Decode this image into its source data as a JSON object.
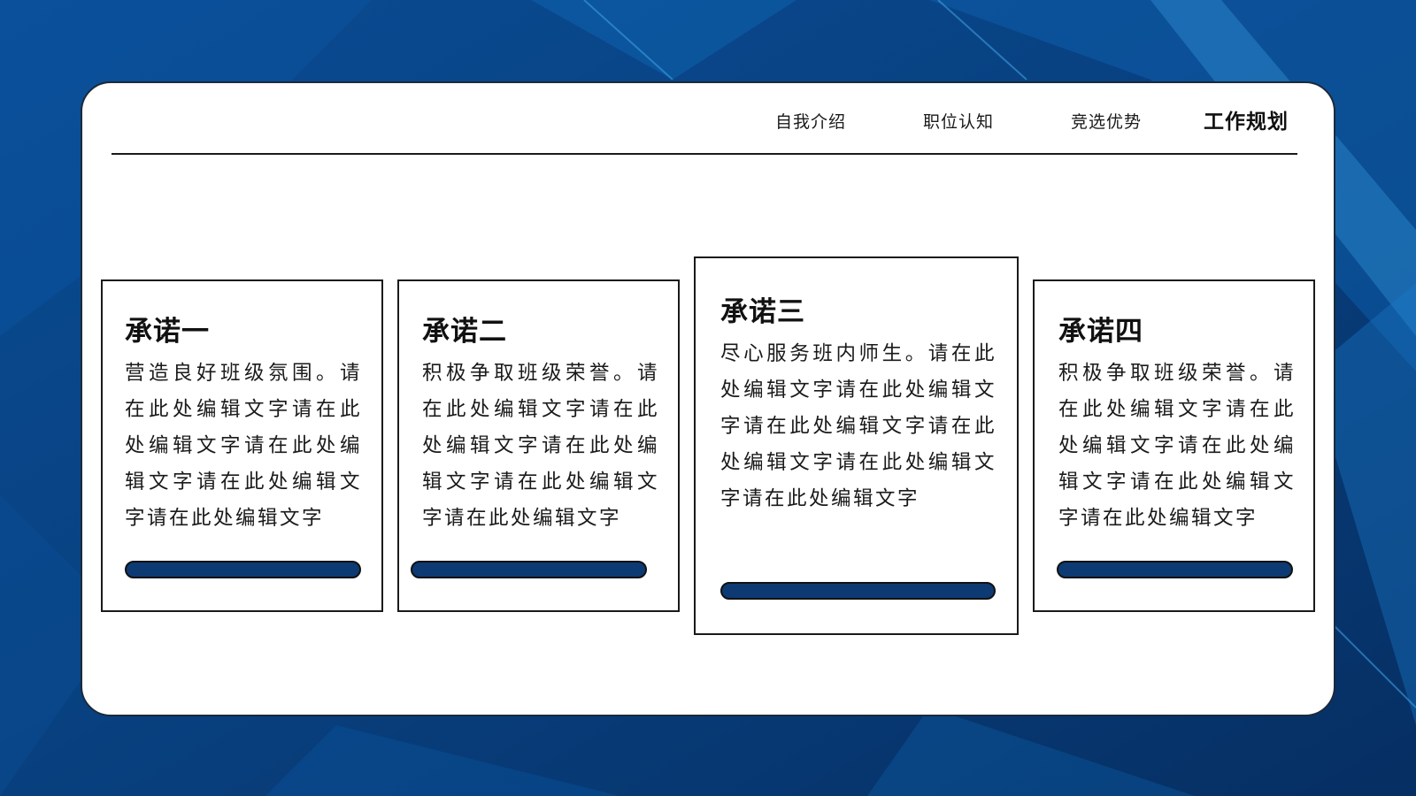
{
  "colors": {
    "background": "#0b3d7a",
    "panel": "#ffffff",
    "accent_bar": "#0d3a73",
    "text": "#1a1a1a"
  },
  "nav": {
    "items": [
      {
        "label": "自我介绍",
        "active": false
      },
      {
        "label": "职位认知",
        "active": false
      },
      {
        "label": "竞选优势",
        "active": false
      },
      {
        "label": "工作规划",
        "active": true
      }
    ]
  },
  "cards": [
    {
      "title": "承诺一",
      "body": "营造良好班级氛围。请在此处编辑文字请在此处编辑文字请在此处编辑文字请在此处编辑文字请在此处编辑文字"
    },
    {
      "title": "承诺二",
      "body": "积极争取班级荣誉。请在此处编辑文字请在此处编辑文字请在此处编辑文字请在此处编辑文字请在此处编辑文字"
    },
    {
      "title": "承诺三",
      "body": "尽心服务班内师生。请在此处编辑文字请在此处编辑文字请在此处编辑文字请在此处编辑文字请在此处编辑文字请在此处编辑文字"
    },
    {
      "title": "承诺四",
      "body": "积极争取班级荣誉。请在此处编辑文字请在此处编辑文字请在此处编辑文字请在此处编辑文字请在此处编辑文字"
    }
  ]
}
